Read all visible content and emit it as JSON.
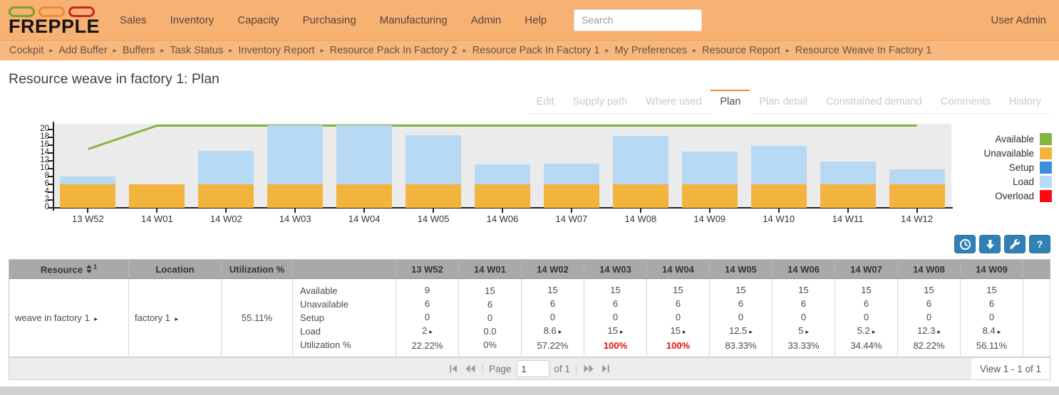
{
  "header": {
    "logo_text": "FREPPLE",
    "nav_items": [
      "Sales",
      "Inventory",
      "Capacity",
      "Purchasing",
      "Manufacturing",
      "Admin",
      "Help"
    ],
    "search_placeholder": "Search",
    "user_label": "User Admin"
  },
  "breadcrumbs": [
    "Cockpit",
    "Add Buffer",
    "Buffers",
    "Task Status",
    "Inventory Report",
    "Resource Pack In Factory 2",
    "Resource Pack In Factory 1",
    "My Preferences",
    "Resource Report",
    "Resource Weave In Factory 1"
  ],
  "page_title": "Resource weave in factory 1: Plan",
  "tabs": [
    {
      "label": "Edit",
      "active": false
    },
    {
      "label": "Supply path",
      "active": false
    },
    {
      "label": "Where used",
      "active": false
    },
    {
      "label": "Plan",
      "active": true
    },
    {
      "label": "Plan detail",
      "active": false
    },
    {
      "label": "Constrained demand",
      "active": false
    },
    {
      "label": "Comments",
      "active": false
    },
    {
      "label": "History",
      "active": false
    }
  ],
  "chart_data": {
    "type": "bar",
    "stacked": true,
    "categories": [
      "13 W52",
      "14 W01",
      "14 W02",
      "14 W03",
      "14 W04",
      "14 W05",
      "14 W06",
      "14 W07",
      "14 W08",
      "14 W09",
      "14 W10",
      "14 W11",
      "14 W12"
    ],
    "series": [
      {
        "name": "Unavailable",
        "color": "#f2b43c",
        "values": [
          6,
          6,
          6,
          6,
          6,
          6,
          6,
          6,
          6,
          6,
          6,
          6,
          6
        ]
      },
      {
        "name": "Setup",
        "color": "#3b8ede",
        "values": [
          0,
          0,
          0,
          0,
          0,
          0,
          0,
          0,
          0,
          0,
          0,
          0,
          0
        ]
      },
      {
        "name": "Load",
        "color": "#b7d9f3",
        "values": [
          2,
          0,
          8.6,
          15,
          15,
          12.5,
          5,
          5.2,
          12.3,
          8.4,
          9.8,
          5.8,
          3.8
        ]
      },
      {
        "name": "Overload",
        "color": "#fb0a10",
        "values": [
          0,
          0,
          0,
          0,
          0,
          0,
          0,
          0,
          0,
          0,
          0,
          0,
          0
        ]
      }
    ],
    "line_series": {
      "name": "Available",
      "color": "#84b63e",
      "values": [
        15,
        21,
        21,
        21,
        21,
        21,
        21,
        21,
        21,
        21,
        21,
        21,
        21
      ]
    },
    "title": "",
    "xlabel": "",
    "ylabel": "",
    "ylim": [
      0,
      21.45
    ],
    "yticks": [
      0,
      2,
      4,
      6,
      8,
      10,
      12,
      14,
      16,
      18,
      20
    ],
    "grid": false,
    "legend_position": "right",
    "plot_background": "#ebebeb",
    "legend": [
      {
        "label": "Available",
        "color": "#84b63e"
      },
      {
        "label": "Unavailable",
        "color": "#f2b43c"
      },
      {
        "label": "Setup",
        "color": "#3b8ede"
      },
      {
        "label": "Load",
        "color": "#b7d9f3"
      },
      {
        "label": "Overload",
        "color": "#fb0a10"
      }
    ]
  },
  "toolbar": {
    "buttons": [
      {
        "name": "time-buckets",
        "icon": "clock-icon"
      },
      {
        "name": "export",
        "icon": "arrow-down-icon"
      },
      {
        "name": "customize",
        "icon": "wrench-icon"
      },
      {
        "name": "help",
        "icon": "question-icon"
      }
    ]
  },
  "table": {
    "headers": {
      "resource": "Resource",
      "resource_sup": "1",
      "location": "Location",
      "utilization": "Utilization %"
    },
    "metric_labels": [
      "Available",
      "Unavailable",
      "Setup",
      "Load",
      "Utilization %"
    ],
    "row": {
      "resource": "weave in factory 1",
      "location": "factory 1",
      "utilization": "55.11%"
    },
    "weeks": [
      {
        "week": "13 W52",
        "available": "9",
        "unavailable": "6",
        "setup": "0",
        "load": "2",
        "load_arrow": true,
        "utilization": "22.22%",
        "overload": false
      },
      {
        "week": "14 W01",
        "available": "15",
        "unavailable": "6",
        "setup": "0",
        "load": "0.0",
        "load_arrow": false,
        "utilization": "0%",
        "overload": false
      },
      {
        "week": "14 W02",
        "available": "15",
        "unavailable": "6",
        "setup": "0",
        "load": "8.6",
        "load_arrow": true,
        "utilization": "57.22%",
        "overload": false
      },
      {
        "week": "14 W03",
        "available": "15",
        "unavailable": "6",
        "setup": "0",
        "load": "15",
        "load_arrow": true,
        "utilization": "100%",
        "overload": true
      },
      {
        "week": "14 W04",
        "available": "15",
        "unavailable": "6",
        "setup": "0",
        "load": "15",
        "load_arrow": true,
        "utilization": "100%",
        "overload": true
      },
      {
        "week": "14 W05",
        "available": "15",
        "unavailable": "6",
        "setup": "0",
        "load": "12.5",
        "load_arrow": true,
        "utilization": "83.33%",
        "overload": false
      },
      {
        "week": "14 W06",
        "available": "15",
        "unavailable": "6",
        "setup": "0",
        "load": "5",
        "load_arrow": true,
        "utilization": "33.33%",
        "overload": false
      },
      {
        "week": "14 W07",
        "available": "15",
        "unavailable": "6",
        "setup": "0",
        "load": "5.2",
        "load_arrow": true,
        "utilization": "34.44%",
        "overload": false
      },
      {
        "week": "14 W08",
        "available": "15",
        "unavailable": "6",
        "setup": "0",
        "load": "12.3",
        "load_arrow": true,
        "utilization": "82.22%",
        "overload": false
      },
      {
        "week": "14 W09",
        "available": "15",
        "unavailable": "6",
        "setup": "0",
        "load": "8.4",
        "load_arrow": true,
        "utilization": "56.11%",
        "overload": false
      }
    ]
  },
  "pager": {
    "page_label": "Page",
    "page_value": "1",
    "of_label": "of 1",
    "view_label": "View 1 - 1 of 1"
  }
}
